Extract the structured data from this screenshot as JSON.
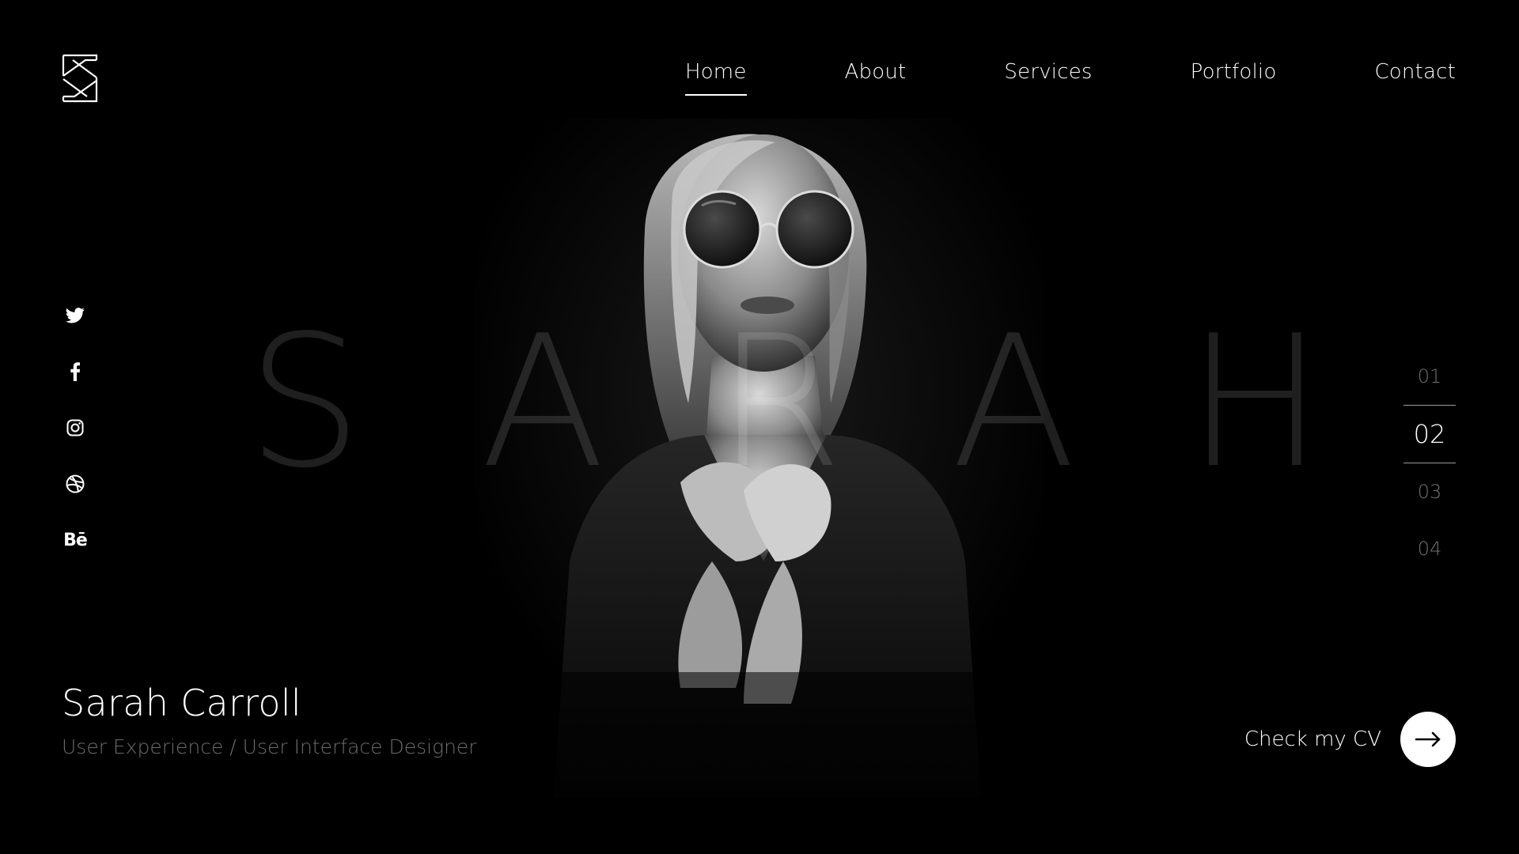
{
  "brand": {
    "logo_letter": "S",
    "logo_icon": "s-monogram-logo"
  },
  "nav": {
    "items": [
      {
        "label": "Home",
        "active": true
      },
      {
        "label": "About",
        "active": false
      },
      {
        "label": "Services",
        "active": false
      },
      {
        "label": "Portfolio",
        "active": false
      },
      {
        "label": "Contact",
        "active": false
      }
    ]
  },
  "watermark": {
    "letters": [
      "S",
      "A",
      "R",
      "A",
      "H"
    ]
  },
  "social": {
    "items": [
      {
        "icon": "twitter-icon"
      },
      {
        "icon": "facebook-icon",
        "glyph": "f"
      },
      {
        "icon": "instagram-icon"
      },
      {
        "icon": "dribbble-icon"
      },
      {
        "icon": "behance-icon",
        "glyph": "Bē"
      }
    ]
  },
  "pager": {
    "items": [
      "01",
      "02",
      "03",
      "04"
    ],
    "active_index": 1
  },
  "hero": {
    "name": "Sarah Carroll",
    "role": "User Experience / User Interface Designer"
  },
  "cv": {
    "label": "Check my CV",
    "icon": "arrow-right-icon"
  },
  "colors": {
    "background": "#000000",
    "text": "#ffffff",
    "muted": "#6c6c6c",
    "button": "#ffffff"
  }
}
